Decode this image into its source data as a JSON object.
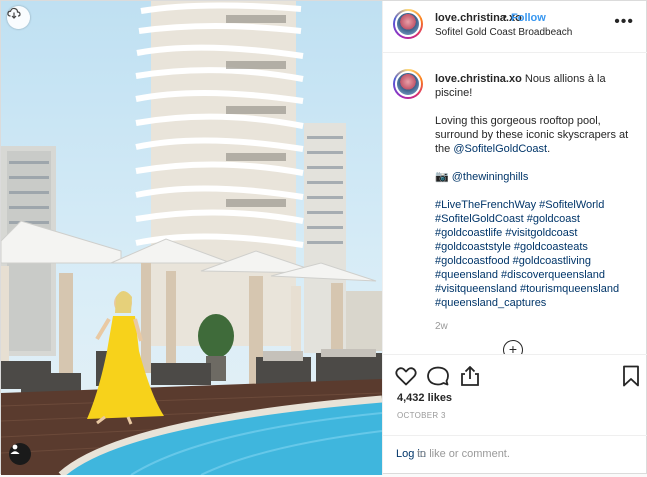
{
  "header": {
    "username": "love.christina.xo",
    "separator": "•",
    "follow_label": "Follow",
    "location": "Sofitel Gold Coast Broadbeach"
  },
  "caption": {
    "username": "love.christina.xo",
    "line1": "Nous allions à la piscine!",
    "line2": "Loving this gorgeous rooftop pool, surround by these iconic skyscrapers at the",
    "mention1": "@SofitelGoldCoast",
    "line2_end": ".",
    "camera_glyph": "📷",
    "mention2": "@thewininghills",
    "hashtags": "#LiveTheFrenchWay #SofitelWorld #SofitelGoldCoast #goldcoast #goldcoastlife #visitgoldcoast #goldcoaststyle #goldcoasteats #goldcoastfood #goldcoastliving #queensland #discoverqueensland #visitqueensland #tourismqueensland #queensland_captures",
    "time_ago": "2w"
  },
  "load_more_label": "+",
  "actions": {
    "likes": "4,432 likes",
    "date": "OCTOBER 3"
  },
  "login": {
    "link": "Log in",
    "rest": "to like or comment."
  },
  "colors": {
    "link_blue": "#3897f0",
    "tag_blue": "#003569",
    "dress_yellow": "#f7d21b",
    "pool": "#3fb6dd"
  }
}
